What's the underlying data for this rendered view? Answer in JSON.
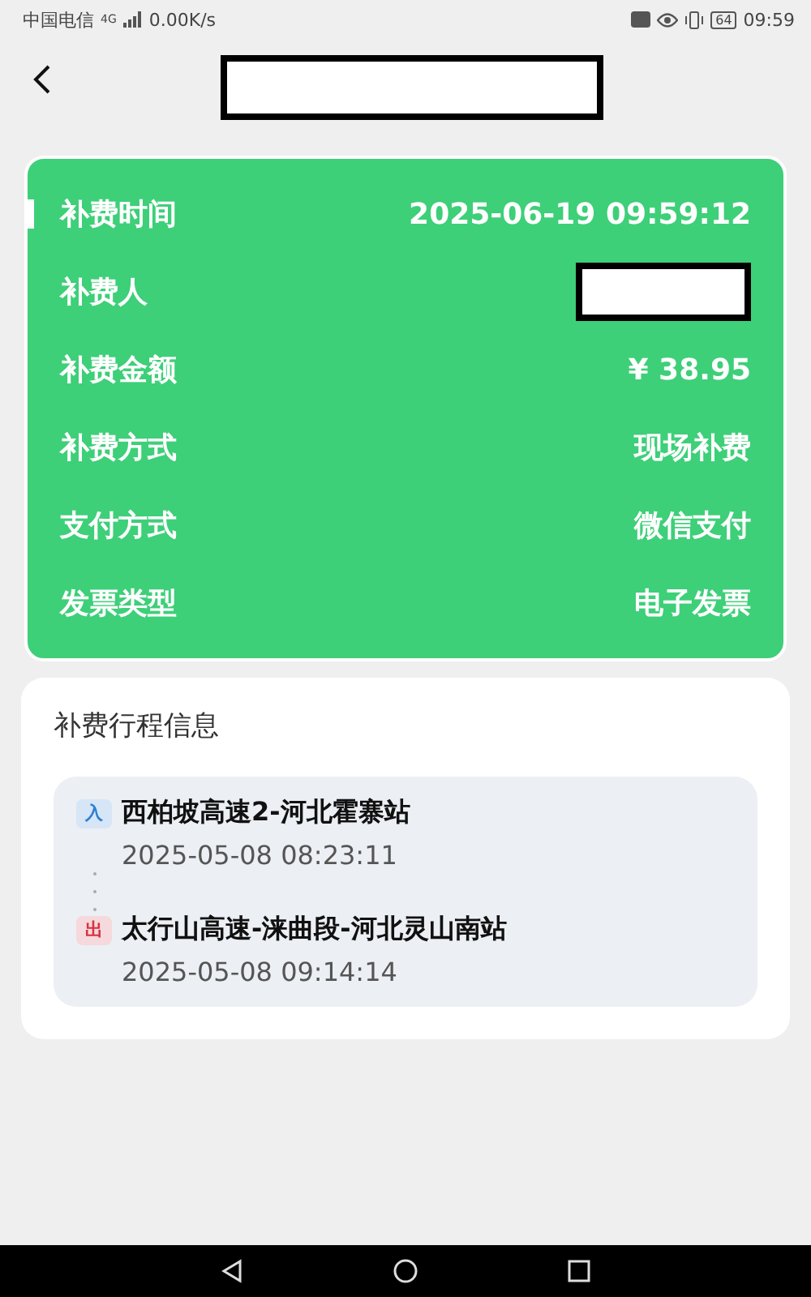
{
  "status_bar": {
    "carrier": "中国电信",
    "signal_type": "4G",
    "speed": "0.00K/s",
    "battery": "64",
    "time": "09:59"
  },
  "header": {
    "title_redacted": true
  },
  "summary": {
    "rows": [
      {
        "label": "补费时间",
        "kind": "text",
        "value": "2025-06-19 09:59:12",
        "selected": true
      },
      {
        "label": "补费人",
        "kind": "redacted",
        "selected": false
      },
      {
        "label": "补费金额",
        "kind": "text",
        "value": "¥ 38.95",
        "selected": false
      },
      {
        "label": "补费方式",
        "kind": "text",
        "value": "现场补费",
        "selected": false
      },
      {
        "label": "支付方式",
        "kind": "text",
        "value": "微信支付",
        "selected": false
      },
      {
        "label": "发票类型",
        "kind": "text",
        "value": "电子发票",
        "selected": false
      }
    ]
  },
  "trip": {
    "title": "补费行程信息",
    "stops": [
      {
        "kind": "entry",
        "badge": "入",
        "station": "西柏坡高速2-河北霍寨站",
        "time": "2025-05-08 08:23:11"
      },
      {
        "kind": "exit",
        "badge": "出",
        "station": "太行山高速-涞曲段-河北灵山南站",
        "time": "2025-05-08 09:14:14"
      }
    ]
  }
}
